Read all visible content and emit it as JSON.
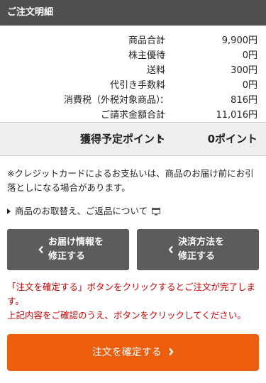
{
  "header": {
    "title": "ご注文明細"
  },
  "summary": {
    "colon": "：",
    "rows": [
      {
        "label": "商品合計",
        "value": "9,900円"
      },
      {
        "label": "株主優待",
        "value": "0円"
      },
      {
        "label": "送料",
        "value": "300円"
      },
      {
        "label": "代引き手数料",
        "value": "0円"
      },
      {
        "label": "消費税（外税対象商品）",
        "value": "816円"
      },
      {
        "label": "ご請求金額合計",
        "value": "11,016円"
      }
    ]
  },
  "points": {
    "label": "獲得予定ポイント",
    "colon": "：",
    "value": "0ポイント"
  },
  "notice": "※クレジットカードによるお支払いは、商品のお届け前にお引落としになる場合があります。",
  "link": {
    "label": "商品のお取替え、ご返品について",
    "icon": "pc-window-icon"
  },
  "buttons": {
    "edit_delivery": "お届け情報を\n修正する",
    "edit_payment": "決済方法を\n修正する"
  },
  "warning": {
    "line1": "「注文を確定する」ボタンをクリックするとご注文が完了します。",
    "line2": "上記内容をご確認のうえ、ボタンをクリックしてください。"
  },
  "confirm": {
    "label": "注文を確定する"
  },
  "colors": {
    "header_bg": "#4f4f4f",
    "button_gray": "#5c5c5c",
    "confirm_orange": "#ec5d0e",
    "warning_red": "#c40000",
    "points_bg": "#eeeeee"
  }
}
